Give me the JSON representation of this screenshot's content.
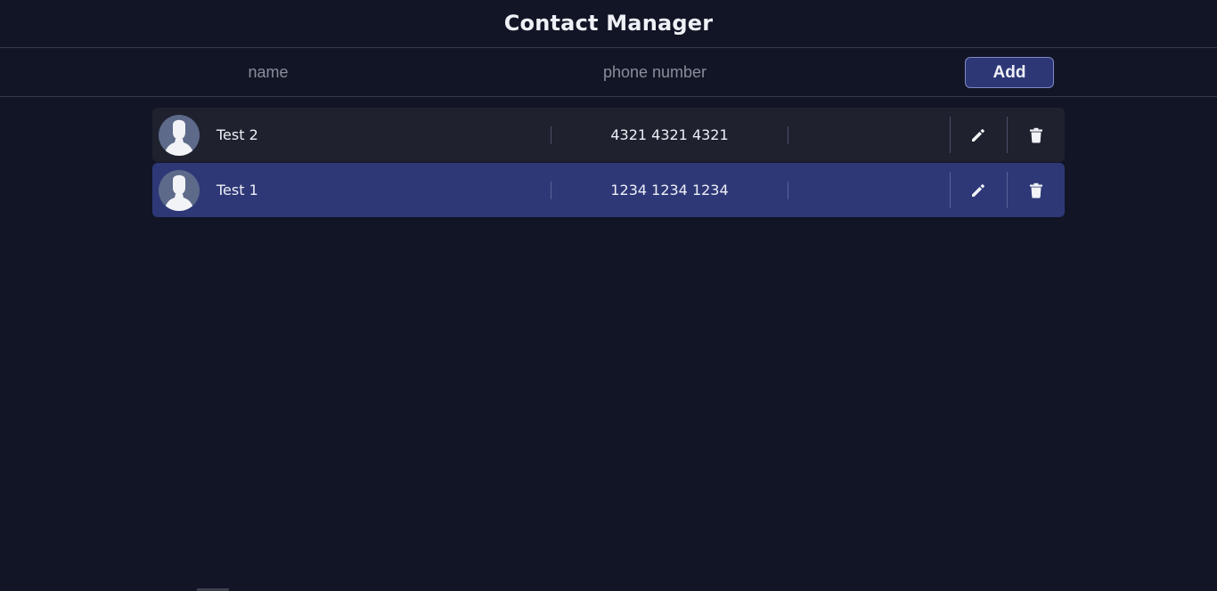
{
  "header": {
    "title": "Contact Manager"
  },
  "form": {
    "name_placeholder": "name",
    "phone_placeholder": "phone number",
    "add_label": "Add"
  },
  "contacts": [
    {
      "name": "Test 2",
      "phone": "4321 4321 4321",
      "selected": false
    },
    {
      "name": "Test 1",
      "phone": "1234 1234 1234",
      "selected": true
    }
  ],
  "icons": {
    "avatar": "user-silhouette-icon",
    "edit": "pencil-icon",
    "delete": "trash-icon"
  },
  "colors": {
    "background": "#111525",
    "row": "#1f212f",
    "row_selected": "#2e3877",
    "accent_button": "#2e3776"
  }
}
